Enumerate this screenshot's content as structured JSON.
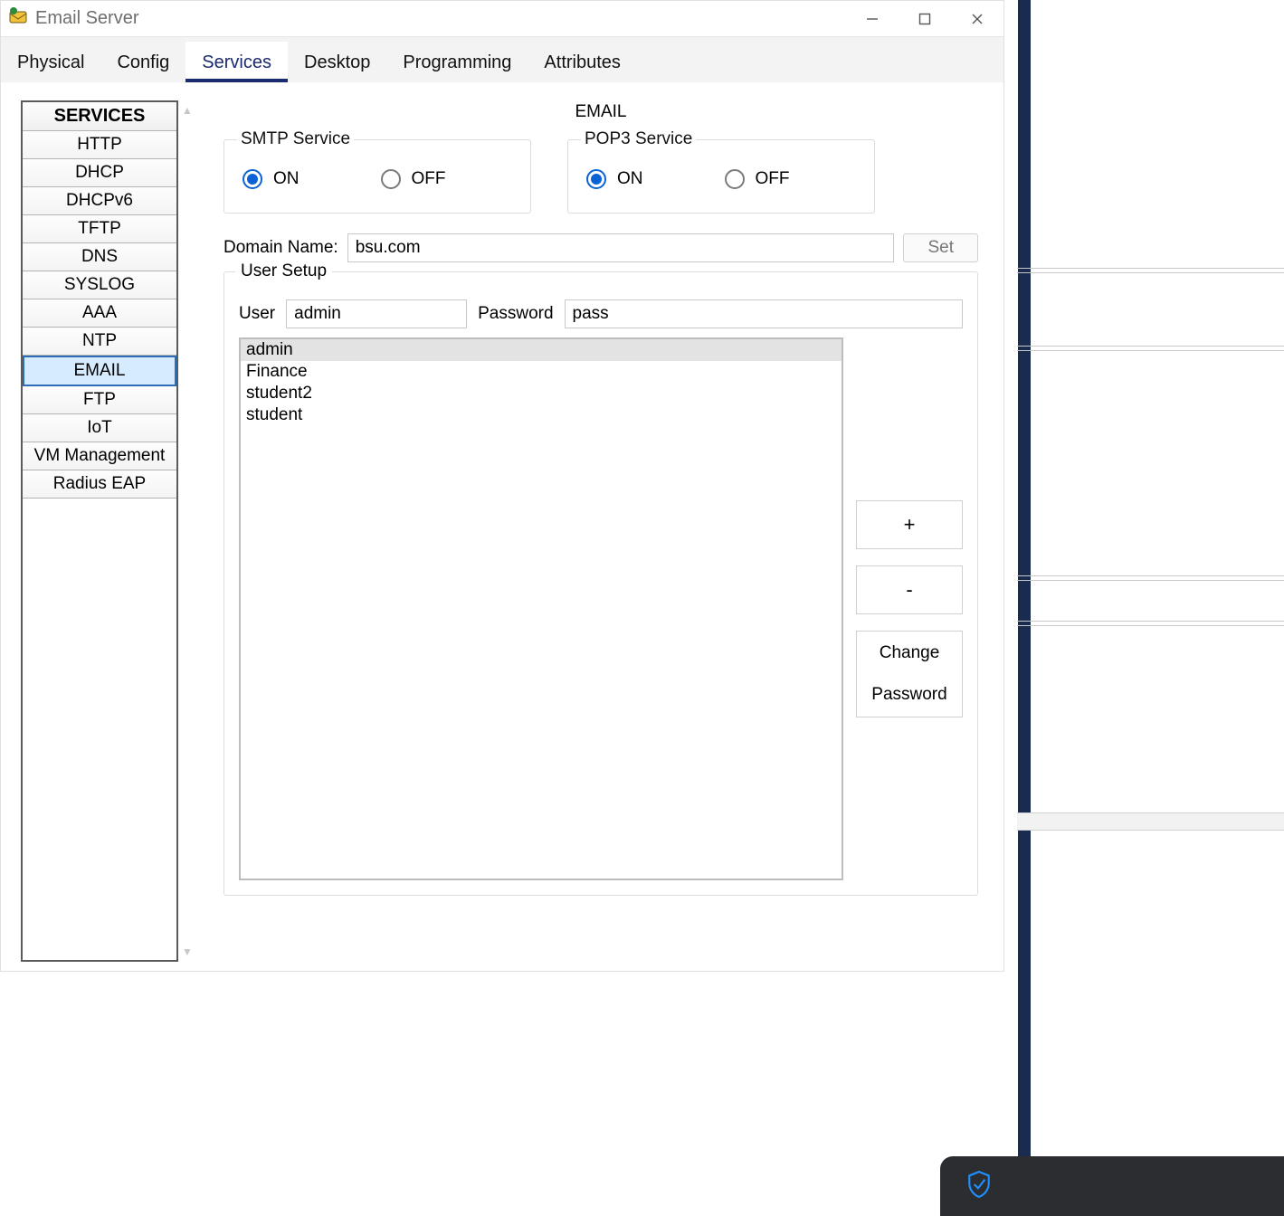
{
  "window": {
    "title": "Email Server"
  },
  "tabs": {
    "items": [
      "Physical",
      "Config",
      "Services",
      "Desktop",
      "Programming",
      "Attributes"
    ],
    "active": 2
  },
  "sidebar": {
    "heading": "SERVICES",
    "items": [
      "HTTP",
      "DHCP",
      "DHCPv6",
      "TFTP",
      "DNS",
      "SYSLOG",
      "AAA",
      "NTP",
      "EMAIL",
      "FTP",
      "IoT",
      "VM Management",
      "Radius EAP"
    ],
    "selected": 8
  },
  "email": {
    "page_title": "EMAIL",
    "smtp": {
      "legend": "SMTP Service",
      "on_label": "ON",
      "off_label": "OFF",
      "value": "ON"
    },
    "pop3": {
      "legend": "POP3 Service",
      "on_label": "ON",
      "off_label": "OFF",
      "value": "ON"
    },
    "domain_label": "Domain Name:",
    "domain_value": "bsu.com",
    "set_button": "Set",
    "user_setup_legend": "User Setup",
    "user_label": "User",
    "user_value": "admin",
    "password_label": "Password",
    "password_value": "pass",
    "users": [
      "admin",
      "Finance",
      "student2",
      "student"
    ],
    "selected_user": 0,
    "add_button": "+",
    "remove_button": "-",
    "change_pw_line1": "Change",
    "change_pw_line2": "Password"
  }
}
